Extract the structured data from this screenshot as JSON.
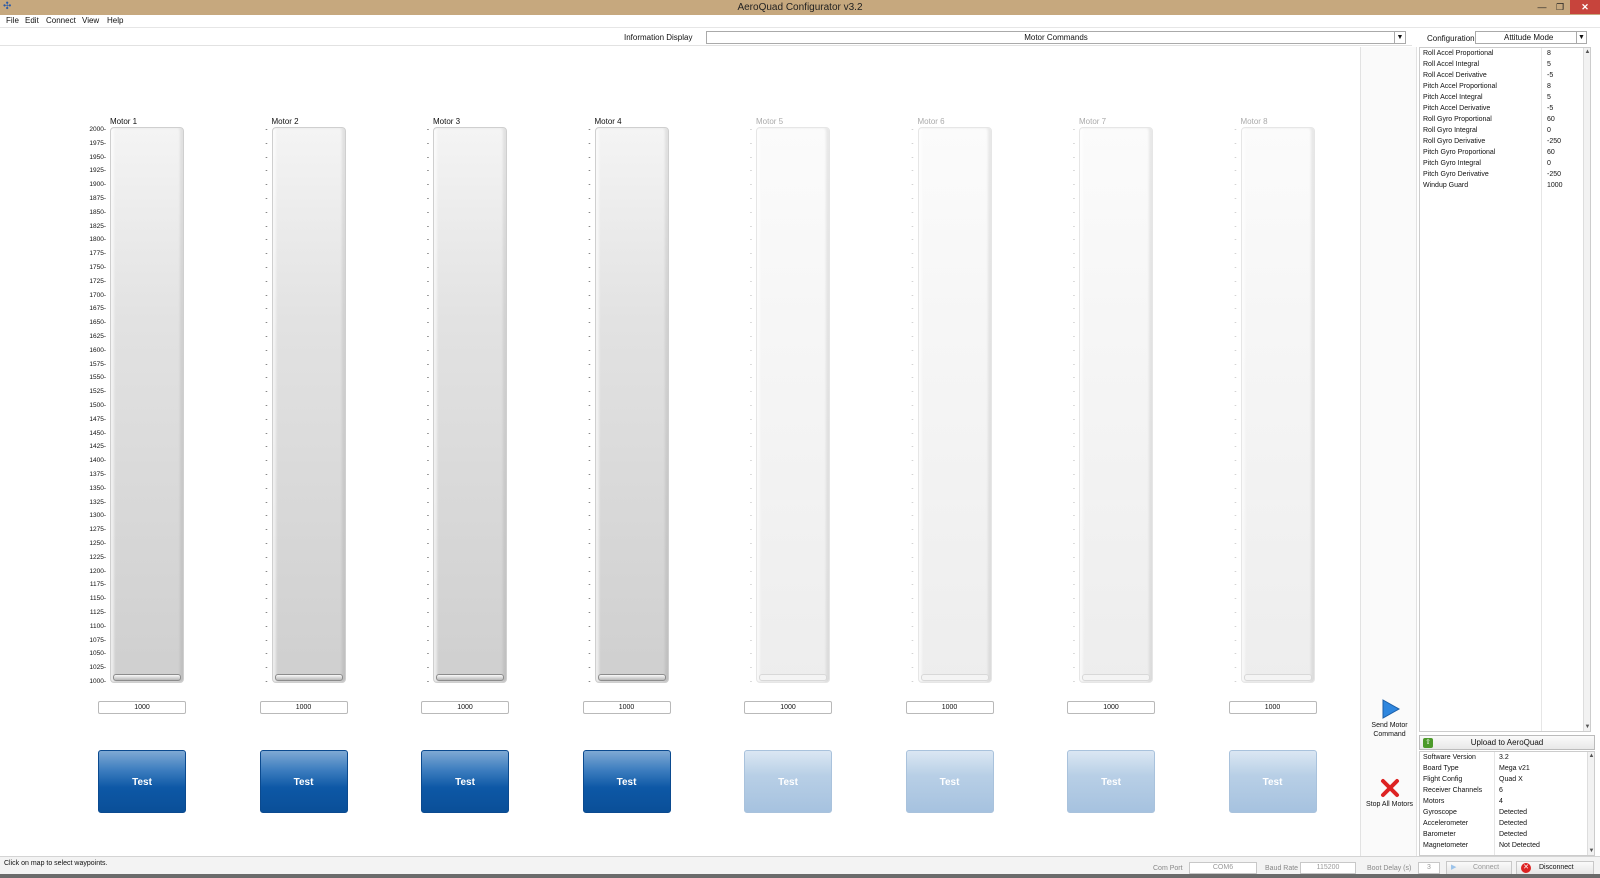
{
  "window": {
    "title": "AeroQuad Configurator v3.2"
  },
  "menu": {
    "file": "File",
    "edit": "Edit",
    "connect": "Connect",
    "view": "View",
    "help": "Help"
  },
  "info_display": {
    "label": "Information Display",
    "selected": "Motor Commands"
  },
  "motors": [
    {
      "label": "Motor 1",
      "value": "1000",
      "test": "Test",
      "enabled": true
    },
    {
      "label": "Motor 2",
      "value": "1000",
      "test": "Test",
      "enabled": true
    },
    {
      "label": "Motor 3",
      "value": "1000",
      "test": "Test",
      "enabled": true
    },
    {
      "label": "Motor 4",
      "value": "1000",
      "test": "Test",
      "enabled": true
    },
    {
      "label": "Motor 5",
      "value": "1000",
      "test": "Test",
      "enabled": false
    },
    {
      "label": "Motor 6",
      "value": "1000",
      "test": "Test",
      "enabled": false
    },
    {
      "label": "Motor 7",
      "value": "1000",
      "test": "Test",
      "enabled": false
    },
    {
      "label": "Motor 8",
      "value": "1000",
      "test": "Test",
      "enabled": false
    }
  ],
  "scale_ticks": [
    "2000",
    "1975",
    "1950",
    "1925",
    "1900",
    "1875",
    "1850",
    "1825",
    "1800",
    "1775",
    "1750",
    "1725",
    "1700",
    "1675",
    "1650",
    "1625",
    "1600",
    "1575",
    "1550",
    "1525",
    "1500",
    "1475",
    "1450",
    "1425",
    "1400",
    "1375",
    "1350",
    "1325",
    "1300",
    "1275",
    "1250",
    "1225",
    "1200",
    "1175",
    "1150",
    "1125",
    "1100",
    "1075",
    "1050",
    "1025",
    "1000"
  ],
  "commands": {
    "send": "Send Motor Command",
    "stop": "Stop All Motors"
  },
  "configuration": {
    "label": "Configuration",
    "selected": "Attitude Mode",
    "params": [
      {
        "name": "Roll Accel Proportional",
        "value": "8"
      },
      {
        "name": "Roll Accel Integral",
        "value": "5"
      },
      {
        "name": "Roll Accel Derivative",
        "value": "-5"
      },
      {
        "name": "Pitch Accel Proportional",
        "value": "8"
      },
      {
        "name": "Pitch Accel Integral",
        "value": "5"
      },
      {
        "name": "Pitch Accel Derivative",
        "value": "-5"
      },
      {
        "name": "Roll Gyro Proportional",
        "value": "60"
      },
      {
        "name": "Roll Gyro Integral",
        "value": "0"
      },
      {
        "name": "Roll Gyro Derivative",
        "value": "-250"
      },
      {
        "name": "Pitch Gyro Proportional",
        "value": "60"
      },
      {
        "name": "Pitch Gyro Integral",
        "value": "0"
      },
      {
        "name": "Pitch Gyro Derivative",
        "value": "-250"
      },
      {
        "name": "Windup Guard",
        "value": "1000"
      }
    ],
    "upload": "Upload to AeroQuad"
  },
  "info": [
    {
      "name": "Software Version",
      "value": "3.2"
    },
    {
      "name": "Board Type",
      "value": "Mega v21"
    },
    {
      "name": "Flight Config",
      "value": "Quad X"
    },
    {
      "name": "Receiver Channels",
      "value": "6"
    },
    {
      "name": "Motors",
      "value": "4"
    },
    {
      "name": "Gyroscope",
      "value": "Detected"
    },
    {
      "name": "Accelerometer",
      "value": "Detected"
    },
    {
      "name": "Barometer",
      "value": "Detected"
    },
    {
      "name": "Magnetometer",
      "value": "Not Detected"
    }
  ],
  "status": {
    "message": "Click on map to select waypoints.",
    "com_port_label": "Com Port",
    "com_port": "COM6",
    "baud_label": "Baud Rate",
    "baud": "115200",
    "boot_label": "Boot Delay (s)",
    "boot": "3",
    "connect": "Connect",
    "disconnect": "Disconnect"
  },
  "colors": {
    "title_bar": "#c6a87e",
    "test_button": "#0d58a6",
    "close": "#c7443c",
    "send_arrow": "#2e86de",
    "stop_x": "#d22"
  }
}
